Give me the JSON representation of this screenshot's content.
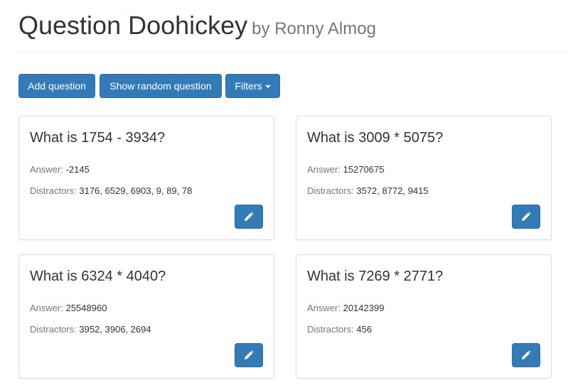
{
  "header": {
    "title": "Question Doohickey",
    "byline": "by Ronny Almog"
  },
  "toolbar": {
    "add_label": "Add question",
    "random_label": "Show random question",
    "filters_label": "Filters"
  },
  "labels": {
    "answer": "Answer:",
    "distractors": "Distractors:"
  },
  "questions": [
    {
      "question": "What is 1754 - 3934?",
      "answer": "-2145",
      "distractors": "3176, 6529, 6903, 9, 89, 78"
    },
    {
      "question": "What is 3009 * 5075?",
      "answer": "15270675",
      "distractors": "3572, 8772, 9415"
    },
    {
      "question": "What is 6324 * 4040?",
      "answer": "25548960",
      "distractors": "3952, 3906, 2694"
    },
    {
      "question": "What is 7269 * 2771?",
      "answer": "20142399",
      "distractors": "456"
    }
  ],
  "icons": {
    "edit": "pencil-icon",
    "dropdown": "caret-down-icon"
  },
  "colors": {
    "primary": "#337ab7",
    "primary_border": "#2e6da4",
    "muted_text": "#777777"
  }
}
